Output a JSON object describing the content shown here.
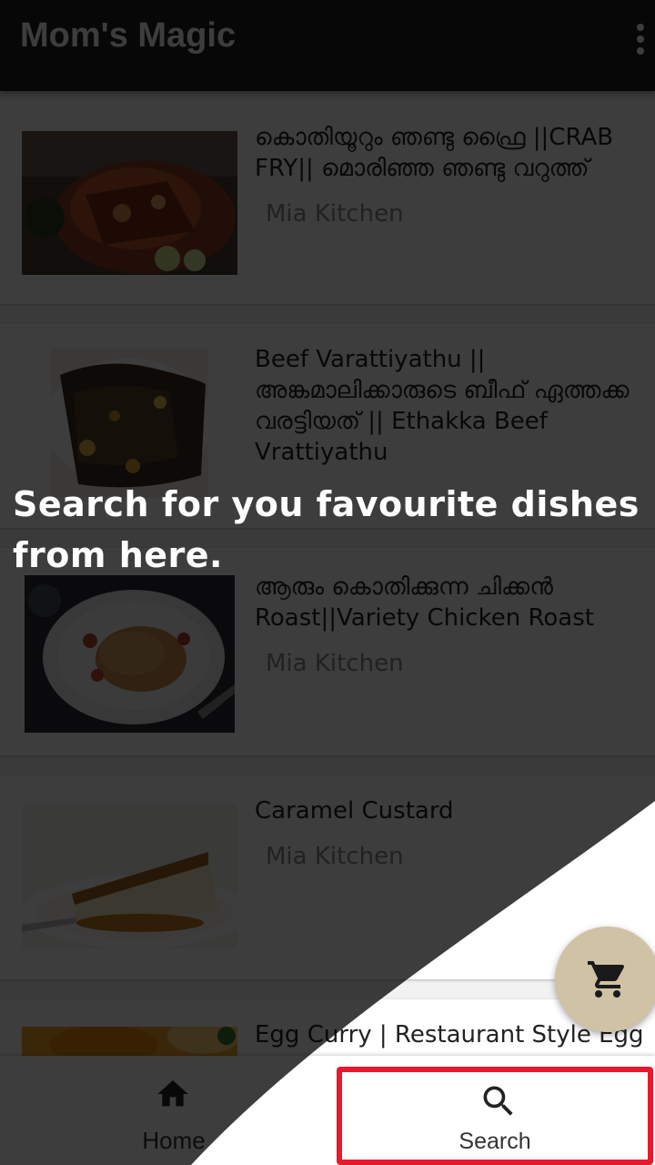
{
  "app": {
    "title": "Mom's Magic"
  },
  "recipes": [
    {
      "title": "കൊതിയൂറും ഞണ്ടു ഫ്രൈ ||CRAB FRY|| മൊരിഞ്ഞ ഞണ്ടു വറുത്ത്",
      "author": "Mia Kitchen",
      "image": "crab-fry-photo"
    },
    {
      "title": "Beef Varattiyathu || അങ്കമാലിക്കാരുടെ ബീഫ് ഏത്തക്ക വരട്ടിയത് || Ethakka Beef Vrattiyathu",
      "author": "",
      "image": "beef-varattiyathu-photo"
    },
    {
      "title": "ആരും കൊതിക്കുന്ന ചിക്കൻ Roast||Variety Chicken Roast",
      "author": "Mia Kitchen",
      "image": "chicken-roast-photo"
    },
    {
      "title": "Caramel Custard",
      "author": "Mia Kitchen",
      "image": "caramel-custard-photo"
    },
    {
      "title": "Egg Curry | Restaurant Style Egg",
      "author": "",
      "image": "egg-curry-photo"
    }
  ],
  "coach_mark": {
    "text": "Search for you favourite dishes from here."
  },
  "fab": {
    "icon": "shopping-cart-icon"
  },
  "bottom_nav": {
    "home": {
      "label": "Home",
      "icon": "home-icon"
    },
    "search": {
      "label": "Search",
      "icon": "search-icon"
    }
  },
  "colors": {
    "appbar": "#212121",
    "highlight": "#e8192c",
    "fab": "#cfc2a5"
  }
}
